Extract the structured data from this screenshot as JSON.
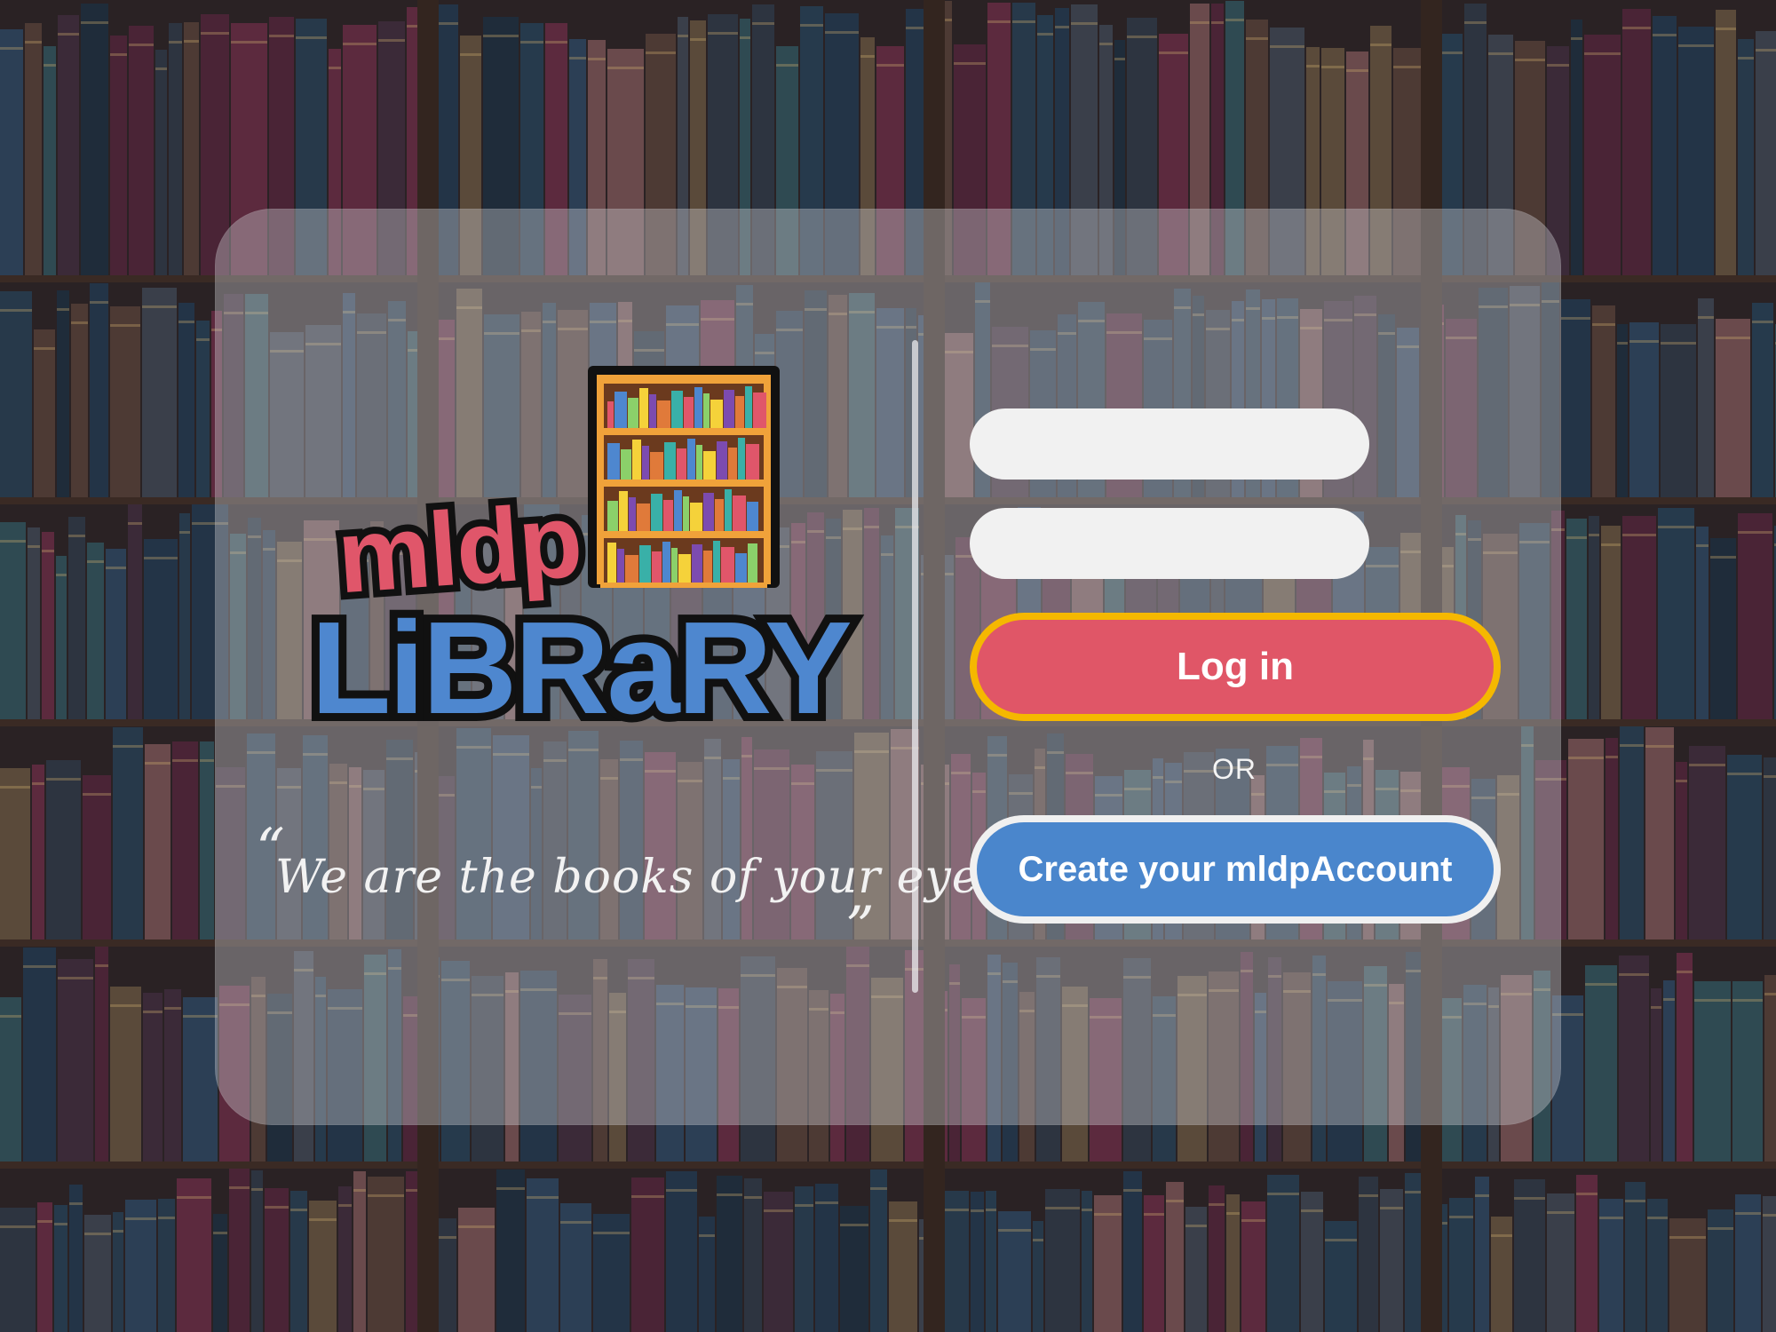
{
  "brand": {
    "logo_line1": "mldp",
    "logo_line2": "LiBRaRY"
  },
  "tagline": {
    "open_quote": "“",
    "text": "We are the books of your eyes",
    "close_quote": "”"
  },
  "form": {
    "username_value": "",
    "password_value": "",
    "login_label": "Log in",
    "or_label": "OR",
    "create_label": "Create your mldpAccount"
  },
  "icons": {
    "logo_bookshelf": "bookshelf-icon"
  },
  "colors": {
    "login_button": "#e05667",
    "login_border": "#f5b800",
    "create_button": "#4a86cc",
    "logo_mldp": "#e0566a",
    "logo_library": "#4e87cf",
    "input_bg": "#f1f1f1"
  }
}
